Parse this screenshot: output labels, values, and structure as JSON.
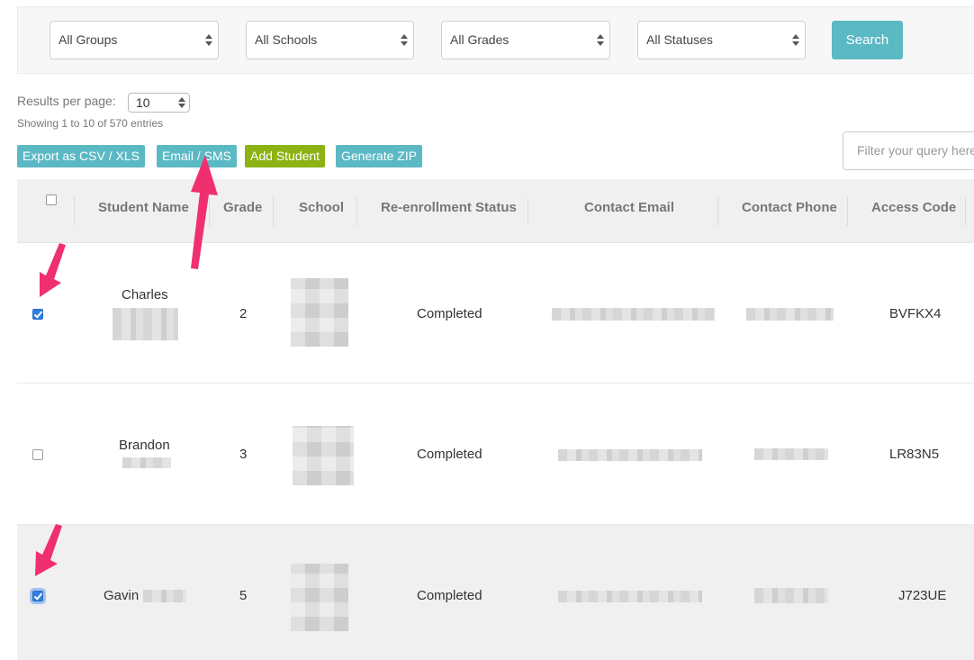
{
  "filters": {
    "groups": "All Groups",
    "schools": "All Schools",
    "grades": "All Grades",
    "statuses": "All Statuses",
    "search_label": "Search"
  },
  "pagination": {
    "results_label": "Results per page:",
    "results_value": "10",
    "showing": "Showing 1 to 10 of 570 entries"
  },
  "actions": {
    "export": "Export as CSV / XLS",
    "email": "Email / SMS",
    "add": "Add Student",
    "zip": "Generate ZIP"
  },
  "filter_query": {
    "placeholder": "Filter your query here"
  },
  "table": {
    "headers": [
      "Student Name",
      "Grade",
      "School",
      "Re-enrollment Status",
      "Contact Email",
      "Contact Phone",
      "Access Code"
    ],
    "rows": [
      {
        "first_name": "Charles",
        "grade": "2",
        "status": "Completed",
        "access_code": "BVFKX4"
      },
      {
        "first_name": "Brandon",
        "grade": "3",
        "status": "Completed",
        "access_code": "LR83N5"
      },
      {
        "first_name": "Gavin",
        "grade": "5",
        "status": "Completed",
        "access_code": "J723UE"
      }
    ]
  },
  "colors": {
    "accent": "#5bb9c4",
    "add_button": "#8cb214",
    "annotation_arrow": "#f0306e",
    "checkbox_checked": "#2f7fe0"
  }
}
